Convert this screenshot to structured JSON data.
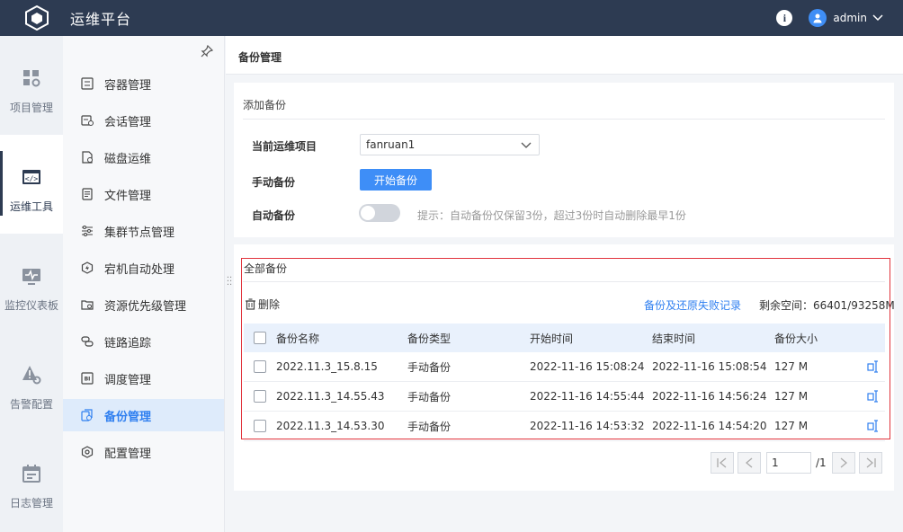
{
  "header": {
    "title": "运维平台",
    "user": "admin"
  },
  "rail": [
    {
      "label": "项目管理",
      "icon": "grid-gear-icon"
    },
    {
      "label": "运维工具",
      "icon": "code-window-icon",
      "active": true
    },
    {
      "label": "监控仪表板",
      "icon": "monitor-icon"
    },
    {
      "label": "告警配置",
      "icon": "alert-gear-icon"
    },
    {
      "label": "日志管理",
      "icon": "calendar-icon"
    }
  ],
  "sidebar": {
    "items": [
      {
        "label": "容器管理",
        "icon": "container-icon"
      },
      {
        "label": "会话管理",
        "icon": "session-icon"
      },
      {
        "label": "磁盘运维",
        "icon": "disk-icon"
      },
      {
        "label": "文件管理",
        "icon": "file-icon"
      },
      {
        "label": "集群节点管理",
        "icon": "sliders-icon"
      },
      {
        "label": "宕机自动处理",
        "icon": "auto-process-icon"
      },
      {
        "label": "资源优先级管理",
        "icon": "priority-icon"
      },
      {
        "label": "链路追踪",
        "icon": "trace-icon"
      },
      {
        "label": "调度管理",
        "icon": "schedule-icon"
      },
      {
        "label": "备份管理",
        "icon": "backup-icon",
        "active": true
      },
      {
        "label": "配置管理",
        "icon": "config-icon"
      }
    ]
  },
  "page": {
    "title": "备份管理",
    "add_card": {
      "title": "添加备份",
      "project_label": "当前运维项目",
      "project_value": "fanruan1",
      "manual_label": "手动备份",
      "start_button": "开始备份",
      "auto_label": "自动备份",
      "auto_enabled": false,
      "hint": "提示：自动备份仅保留3份，超过3份时自动删除最早1份"
    },
    "list_card": {
      "title": "全部备份",
      "delete_label": "删除",
      "fail_link": "备份及还原失败记录",
      "space_label": "剩余空间：66401/93258M",
      "columns": [
        "备份名称",
        "备份类型",
        "开始时间",
        "结束时间",
        "备份大小"
      ],
      "rows": [
        {
          "name": "2022.11.3_15.8.15",
          "type": "手动备份",
          "start": "2022-11-16 15:08:24",
          "end": "2022-11-16 15:08:54",
          "size": "127 M"
        },
        {
          "name": "2022.11.3_14.55.43",
          "type": "手动备份",
          "start": "2022-11-16 14:55:44",
          "end": "2022-11-16 14:56:24",
          "size": "127 M"
        },
        {
          "name": "2022.11.3_14.53.30",
          "type": "手动备份",
          "start": "2022-11-16 14:53:32",
          "end": "2022-11-16 14:54:20",
          "size": "127 M"
        }
      ]
    },
    "pager": {
      "current": "1",
      "total": "/1"
    }
  },
  "colors": {
    "header_bg": "#2d3b52",
    "accent": "#3e8ef7",
    "highlight": "#e1333c"
  }
}
